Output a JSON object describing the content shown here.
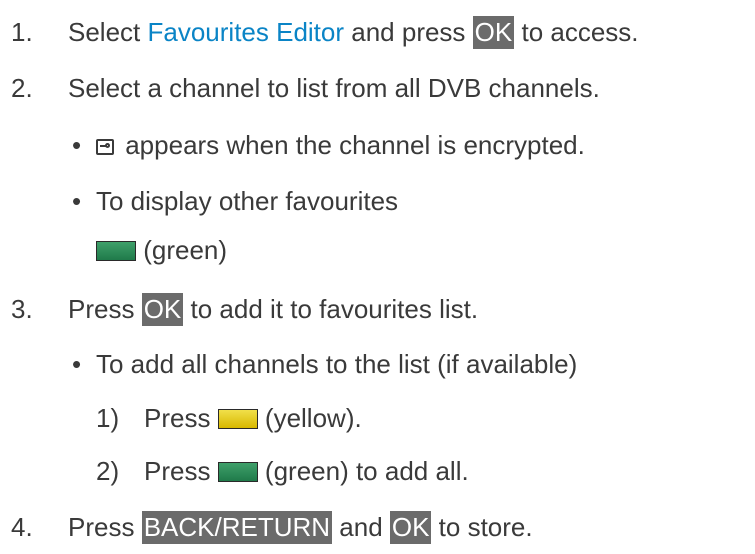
{
  "steps": [
    {
      "num": "1.",
      "pre": "Select ",
      "link": "Favourites Editor",
      "mid": " and press ",
      "key": "OK",
      "post": " to access."
    },
    {
      "num": "2.",
      "text": "Select a channel to list from all DVB channels.",
      "bullets": [
        {
          "icon": "encrypted-icon",
          "text": " appears when the channel is encrypted."
        },
        {
          "text": "To display other favourites",
          "swatch_color": "green",
          "swatch_label": " (green)"
        }
      ]
    },
    {
      "num": "3.",
      "pre": "Press ",
      "key": "OK",
      "post": " to add it to favourites list.",
      "bullets": [
        {
          "text": "To add all channels to the list (if available)",
          "substeps": [
            {
              "num": "1)",
              "pre": "Press ",
              "swatch_color": "yellow",
              "post": " (yellow)."
            },
            {
              "num": "2)",
              "pre": "Press ",
              "swatch_color": "green",
              "post": " (green) to add all."
            }
          ]
        }
      ]
    },
    {
      "num": "4.",
      "pre": "Press ",
      "key": "BACK/RETURN",
      "mid": " and ",
      "key2": "OK",
      "post": " to store."
    }
  ],
  "colors": {
    "text": "#3a3a3a",
    "link": "#0a84c6",
    "key_bg": "#6b6b6b",
    "green": "#2e8b57",
    "yellow": "#e6c800"
  }
}
